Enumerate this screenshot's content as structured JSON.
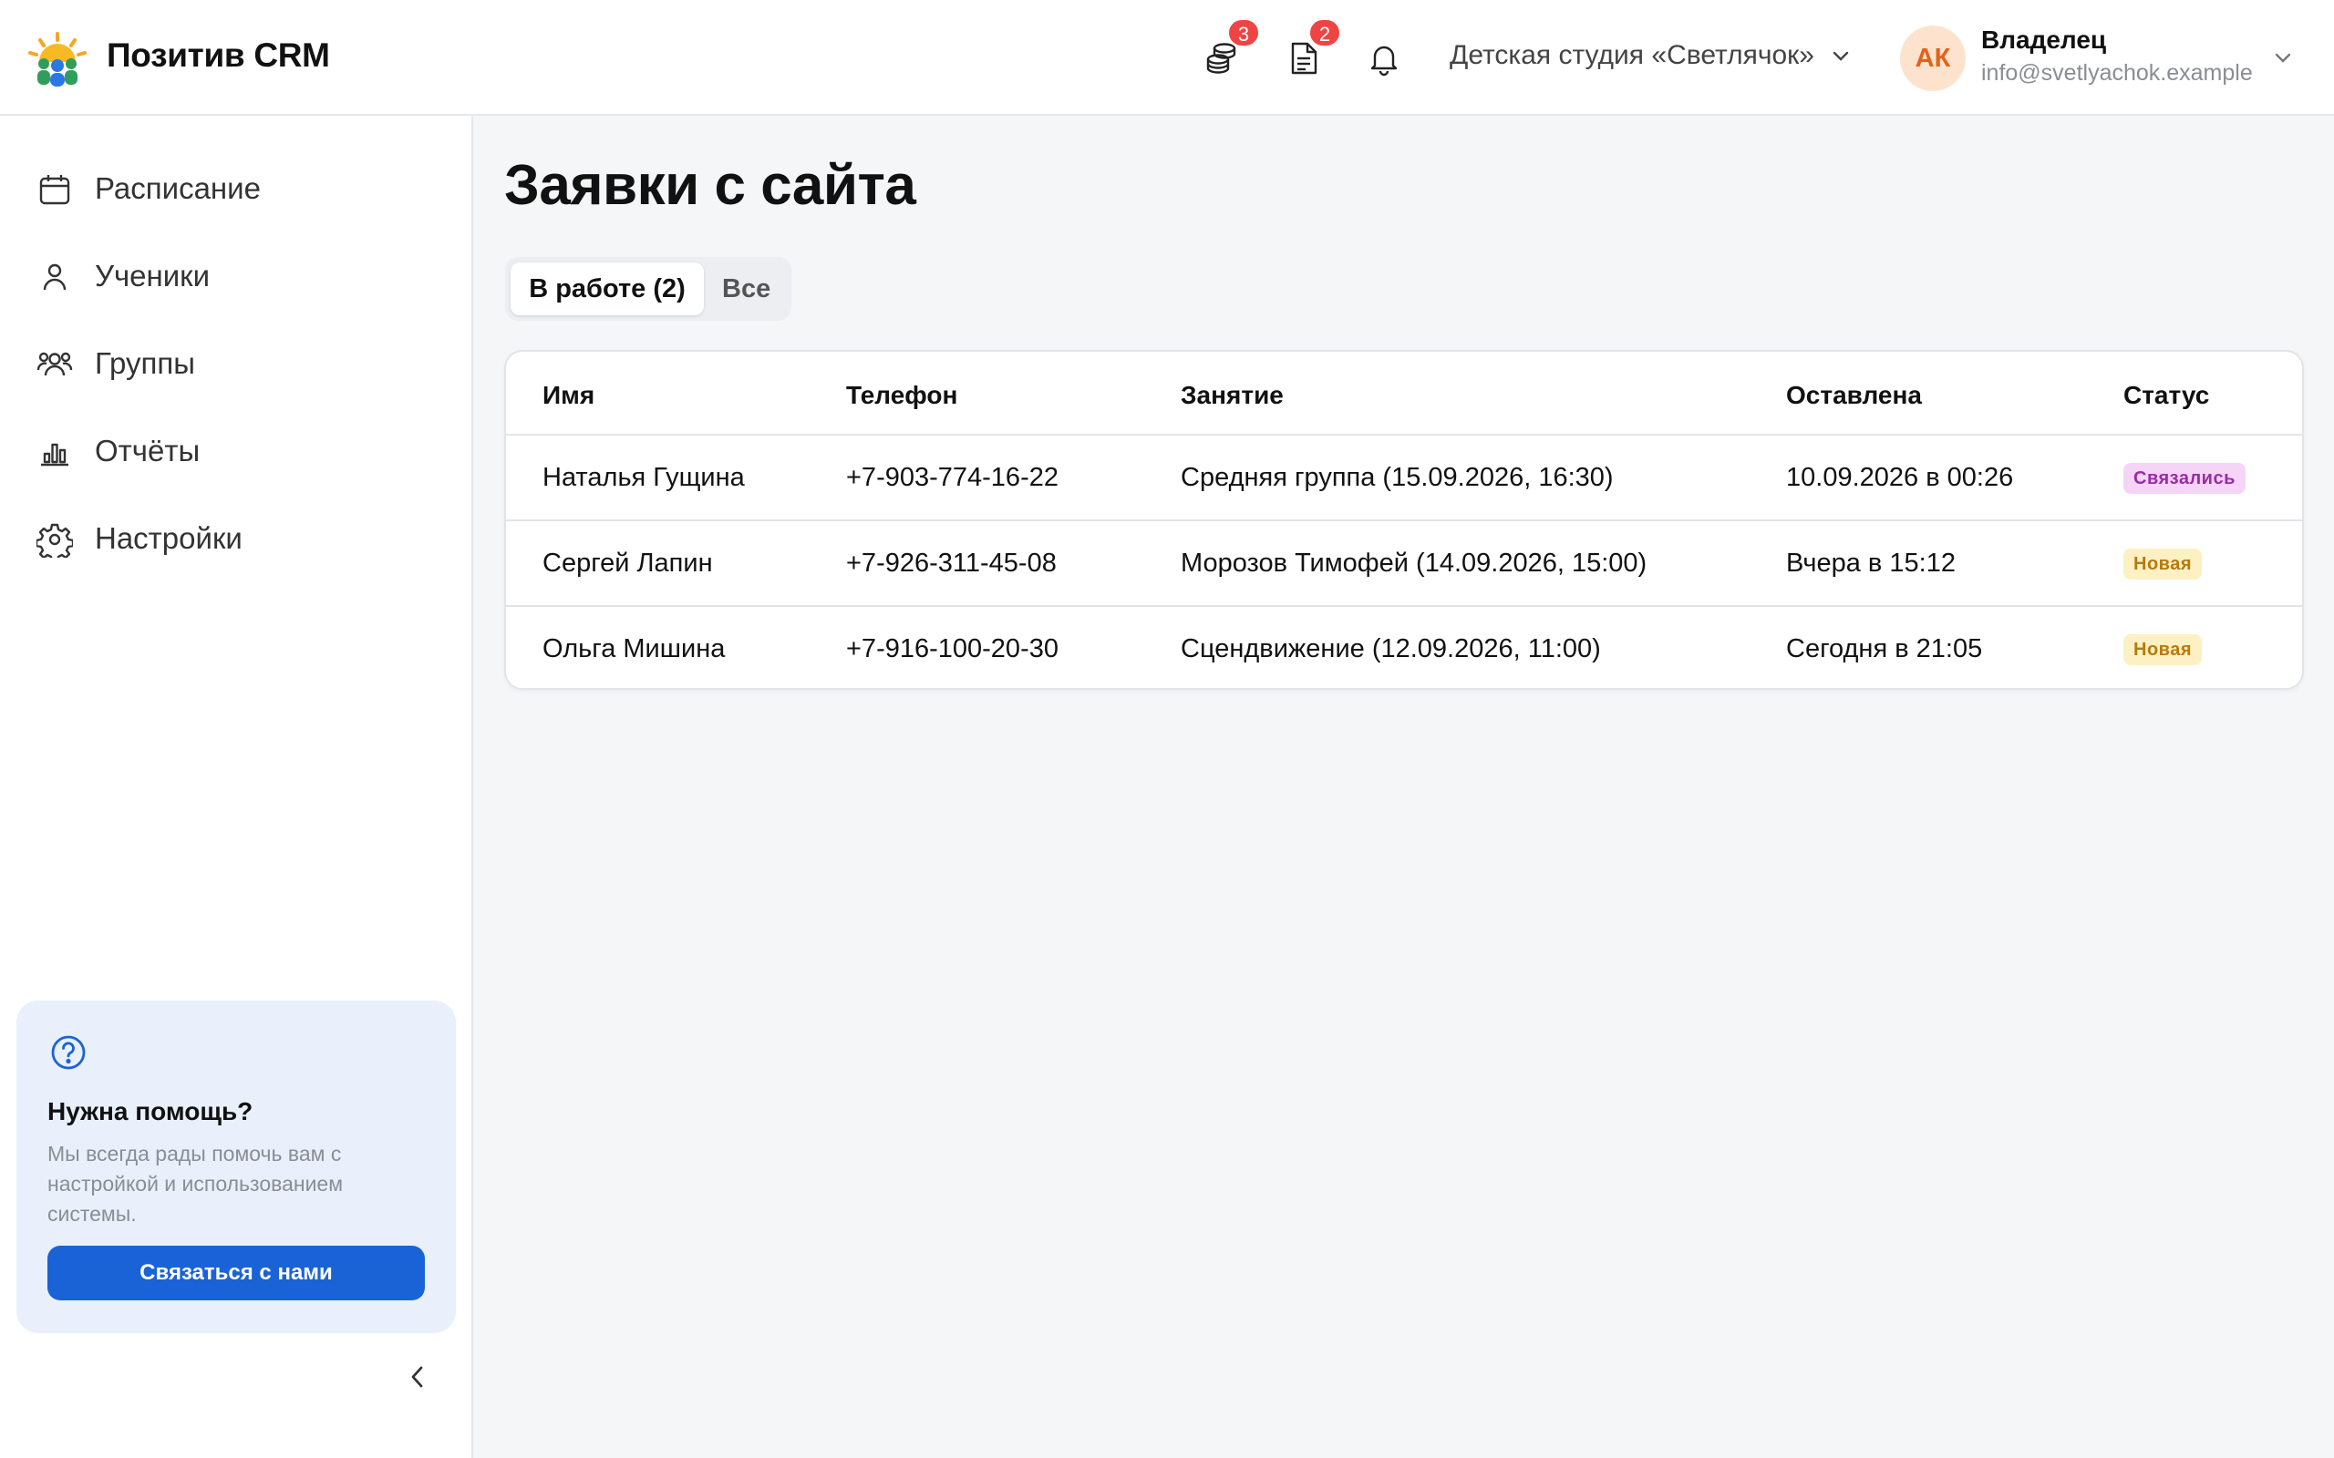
{
  "app": {
    "title": "Позитив CRM"
  },
  "header": {
    "payments_badge": "3",
    "documents_badge": "2",
    "organization": "Детская студия «Светлячок»",
    "user": {
      "initials": "АК",
      "role": "Владелец",
      "email": "info@svetlyachok.example"
    }
  },
  "sidebar": {
    "items": [
      {
        "label": "Расписание",
        "icon": "calendar-icon"
      },
      {
        "label": "Ученики",
        "icon": "user-icon"
      },
      {
        "label": "Группы",
        "icon": "users-icon"
      },
      {
        "label": "Отчёты",
        "icon": "chart-icon"
      },
      {
        "label": "Настройки",
        "icon": "gear-icon"
      }
    ],
    "help": {
      "title": "Нужна помощь?",
      "text": "Мы всегда рады помочь вам с настройкой и использованием системы.",
      "button": "Связаться с нами"
    }
  },
  "main": {
    "title": "Заявки с сайта",
    "tabs": [
      {
        "label": "В работе (2)",
        "active": true
      },
      {
        "label": "Все",
        "active": false
      }
    ],
    "table": {
      "columns": [
        "Имя",
        "Телефон",
        "Занятие",
        "Оставлена",
        "Статус"
      ],
      "rows": [
        {
          "name": "Наталья Гущина",
          "phone": "+7-903-774-16-22",
          "lesson": "Средняя группа (15.09.2026, 16:30)",
          "created": "10.09.2026 в 00:26",
          "status": "Связались"
        },
        {
          "name": "Сергей Лапин",
          "phone": "+7-926-311-45-08",
          "lesson": "Морозов Тимофей (14.09.2026, 15:00)",
          "created": "Вчера в 15:12",
          "status": "Новая"
        },
        {
          "name": "Ольга Мишина",
          "phone": "+7-916-100-20-30",
          "lesson": "Сцендвижение (12.09.2026, 11:00)",
          "created": "Сегодня в 21:05",
          "status": "Новая"
        }
      ]
    }
  },
  "colors": {
    "accent": "#1a63d6",
    "badge_red": "#ef4444",
    "status_contacted": "#f6d4f8",
    "status_new": "#fdf0c2"
  }
}
